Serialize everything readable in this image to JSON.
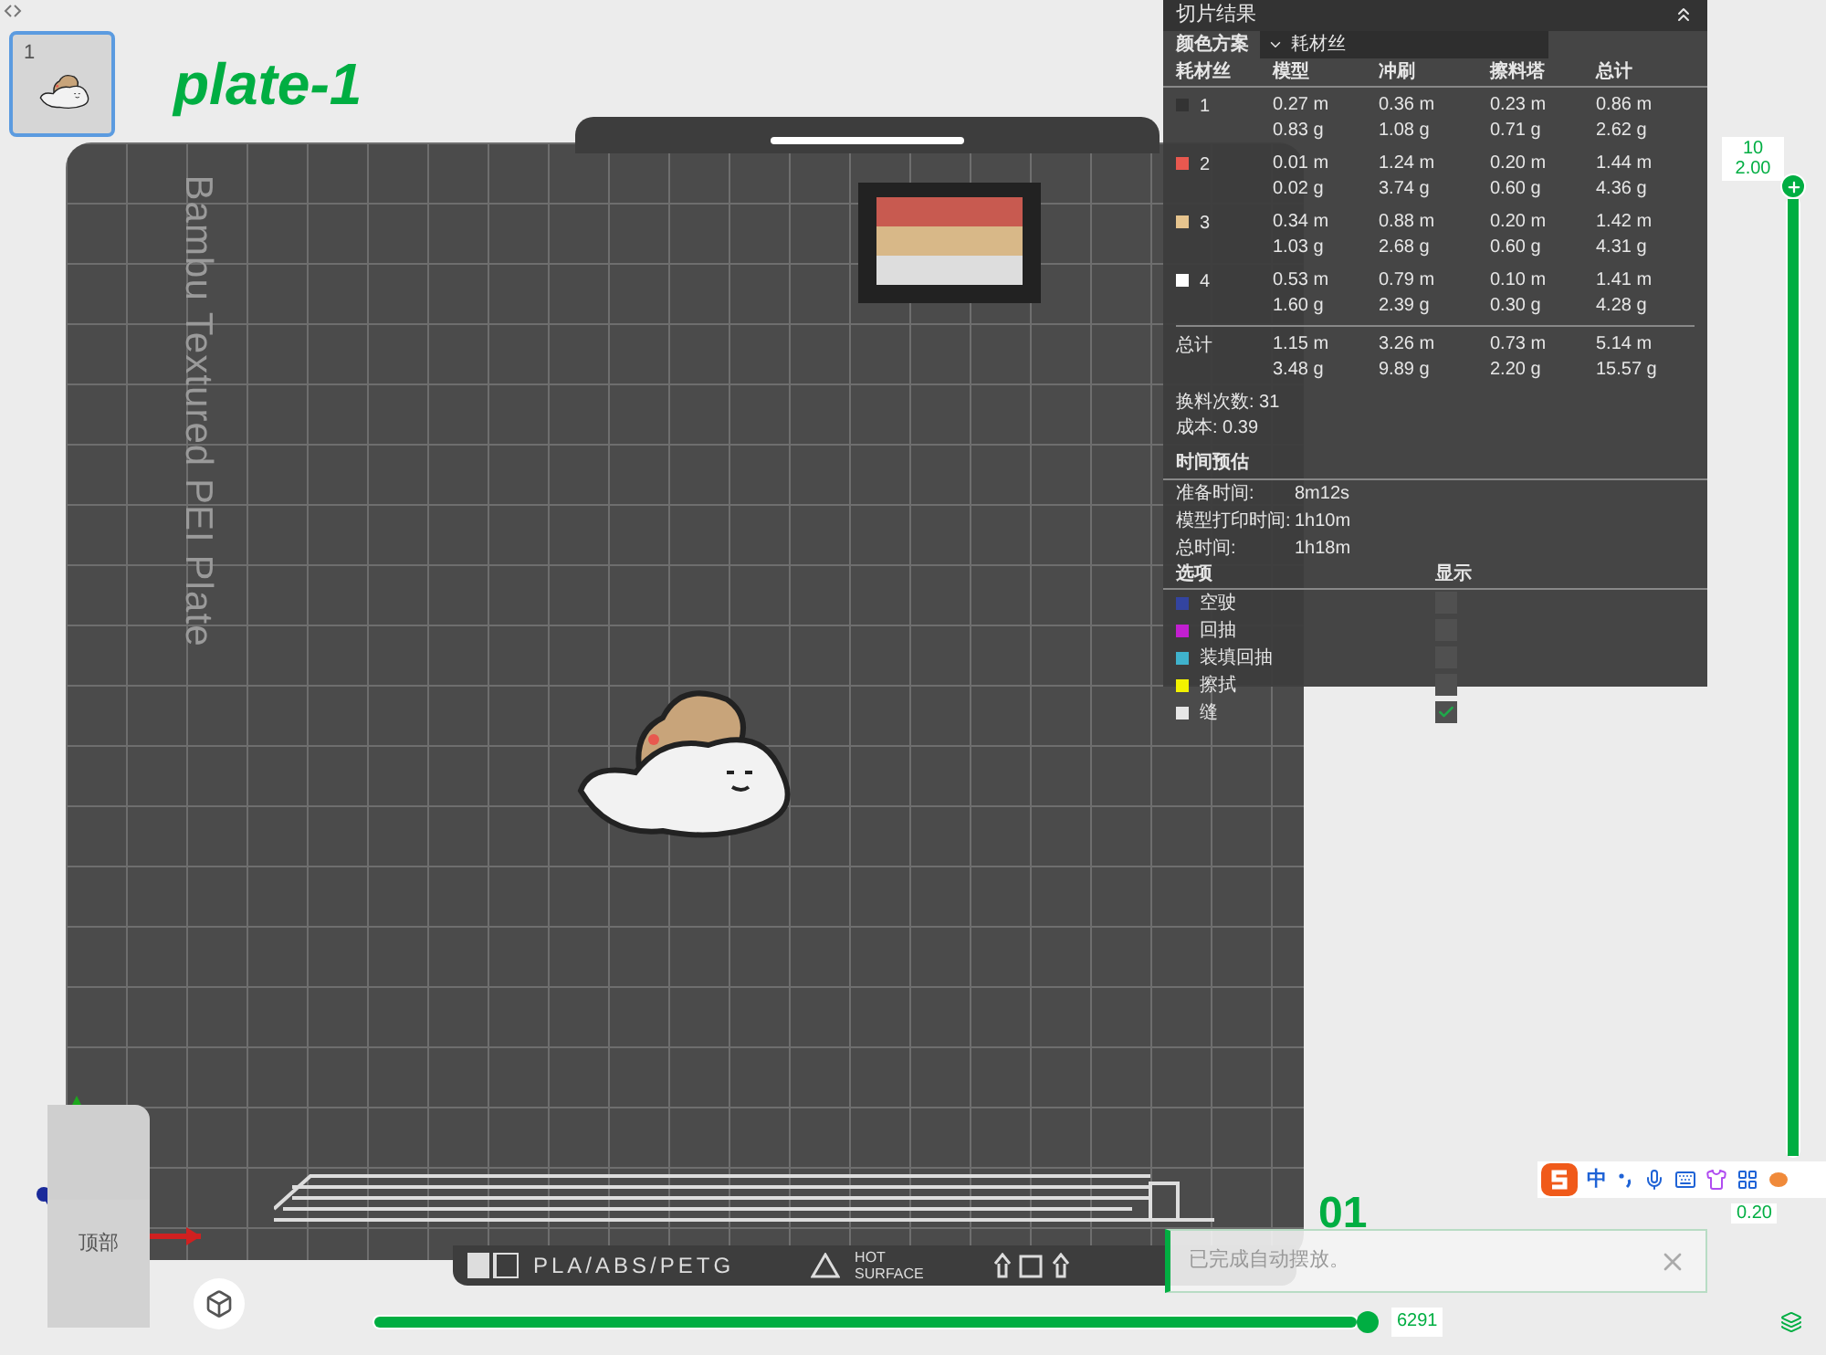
{
  "plate_list": [
    {
      "number": "1",
      "selected": true
    }
  ],
  "plate_title": "plate-1",
  "bed": {
    "name": "Bambu Textured PEI Plate",
    "material_label": "PLA/ABS/PETG",
    "warning": "HOT SURFACE"
  },
  "view_cube": {
    "face": "顶部"
  },
  "slice_panel": {
    "title": "切片结果",
    "color_scheme_label": "颜色方案",
    "color_scheme": "耗材丝",
    "columns": [
      "耗材丝",
      "模型",
      "冲刷",
      "擦料塔",
      "总计"
    ],
    "filaments": [
      {
        "id": "1",
        "color": "#333333",
        "values": [
          [
            "0.27 m",
            "0.83 g"
          ],
          [
            "0.36 m",
            "1.08 g"
          ],
          [
            "0.23 m",
            "0.71 g"
          ],
          [
            "0.86 m",
            "2.62 g"
          ]
        ]
      },
      {
        "id": "2",
        "color": "#e8584f",
        "values": [
          [
            "0.01 m",
            "0.02 g"
          ],
          [
            "1.24 m",
            "3.74 g"
          ],
          [
            "0.20 m",
            "0.60 g"
          ],
          [
            "1.44 m",
            "4.36 g"
          ]
        ]
      },
      {
        "id": "3",
        "color": "#e6c48e",
        "values": [
          [
            "0.34 m",
            "1.03 g"
          ],
          [
            "0.88 m",
            "2.68 g"
          ],
          [
            "0.20 m",
            "0.60 g"
          ],
          [
            "1.42 m",
            "4.31 g"
          ]
        ]
      },
      {
        "id": "4",
        "color": "#ffffff",
        "values": [
          [
            "0.53 m",
            "1.60 g"
          ],
          [
            "0.79 m",
            "2.39 g"
          ],
          [
            "0.10 m",
            "0.30 g"
          ],
          [
            "1.41 m",
            "4.28 g"
          ]
        ]
      }
    ],
    "total": {
      "label": "总计",
      "values": [
        [
          "1.15 m",
          "3.48 g"
        ],
        [
          "3.26 m",
          "9.89 g"
        ],
        [
          "0.73 m",
          "2.20 g"
        ],
        [
          "5.14 m",
          "15.57 g"
        ]
      ]
    },
    "changes": "换料次数: 31",
    "cost": "成本: 0.39",
    "time_title": "时间预估",
    "times": [
      {
        "label": "准备时间:",
        "value": "8m12s"
      },
      {
        "label": "模型打印时间:",
        "value": "1h10m"
      },
      {
        "label": "总时间:",
        "value": "1h18m"
      }
    ],
    "options_header": [
      "选项",
      "显示"
    ],
    "options": [
      {
        "label": "空驶",
        "color": "#3344a0",
        "checked": false
      },
      {
        "label": "回抽",
        "color": "#c21fd0",
        "checked": false
      },
      {
        "label": "装填回抽",
        "color": "#3fb2cc",
        "checked": false
      },
      {
        "label": "擦拭",
        "color": "#f2f200",
        "checked": false
      },
      {
        "label": "缝",
        "color": "#e6e6e6",
        "checked": true
      }
    ]
  },
  "layer_slider": {
    "level": 1,
    "top_label": [
      "10",
      "2.00"
    ],
    "bottom_label": "0.20"
  },
  "move_slider": {
    "level": 1,
    "value": "6291"
  },
  "layer_number": "01",
  "notification": "已完成自动摆放。",
  "ime_toolbar": {
    "mode": "中"
  }
}
